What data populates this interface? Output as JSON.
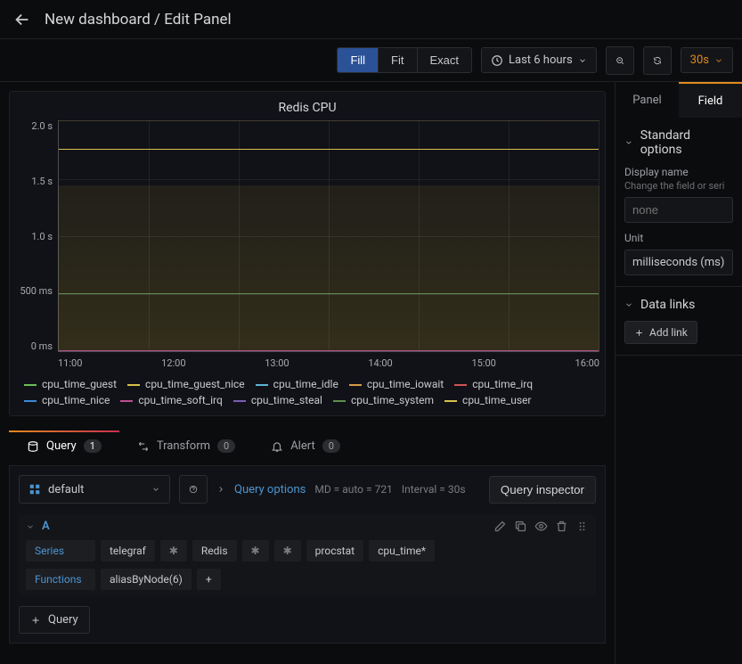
{
  "header": {
    "title": "New dashboard / Edit Panel"
  },
  "toolbar": {
    "fill": "Fill",
    "fit": "Fit",
    "exact": "Exact",
    "timerange": "Last 6 hours",
    "refresh_rate": "30s"
  },
  "right_tabs": {
    "panel": "Panel",
    "field": "Field"
  },
  "standard_options": {
    "title": "Standard options",
    "display_name_label": "Display name",
    "display_name_help": "Change the field or seri",
    "display_name_value": "none",
    "unit_label": "Unit",
    "unit_value": "milliseconds (ms)"
  },
  "data_links": {
    "title": "Data links",
    "add": "Add link"
  },
  "chart_data": {
    "type": "line",
    "title": "Redis CPU",
    "ylabel": "",
    "ylim": [
      0,
      2.0
    ],
    "yunit": "s",
    "y_ticks": [
      "2.0 s",
      "1.5 s",
      "1.0 s",
      "500 ms",
      "0 ms"
    ],
    "x_ticks": [
      "11:00",
      "12:00",
      "13:00",
      "14:00",
      "15:00",
      "16:00"
    ],
    "series": [
      {
        "name": "cpu_time_guest",
        "color": "#6bbf59",
        "value": 0
      },
      {
        "name": "cpu_time_guest_nice",
        "color": "#d6c24a",
        "value": 0
      },
      {
        "name": "cpu_time_idle",
        "color": "#5fb4d8",
        "value": 0
      },
      {
        "name": "cpu_time_iowait",
        "color": "#d89a44",
        "value": 0
      },
      {
        "name": "cpu_time_irq",
        "color": "#cf5454",
        "value": 0
      },
      {
        "name": "cpu_time_nice",
        "color": "#3b8ad8",
        "value": 0
      },
      {
        "name": "cpu_time_soft_irq",
        "color": "#b94f90",
        "value": 0
      },
      {
        "name": "cpu_time_steal",
        "color": "#7a5fb5",
        "value": 0
      },
      {
        "name": "cpu_time_system",
        "color": "#5f8f4f",
        "value": 0.5
      },
      {
        "name": "cpu_time_user",
        "color": "#d6c24a",
        "value": 1.75
      }
    ]
  },
  "bottom_tabs": {
    "query": "Query",
    "query_count": "1",
    "transform": "Transform",
    "transform_count": "0",
    "alert": "Alert",
    "alert_count": "0"
  },
  "query": {
    "datasource": "default",
    "options_label": "Query options",
    "meta_md": "MD = auto = 721",
    "meta_interval": "Interval = 30s",
    "inspector": "Query inspector",
    "row_id": "A",
    "series_label": "Series",
    "series_chips": [
      "telegraf",
      "✱",
      "Redis",
      "✱",
      "✱",
      "procstat",
      "cpu_time*"
    ],
    "functions_label": "Functions",
    "functions_chips": [
      "aliasByNode(6)"
    ],
    "add_query": "Query"
  }
}
